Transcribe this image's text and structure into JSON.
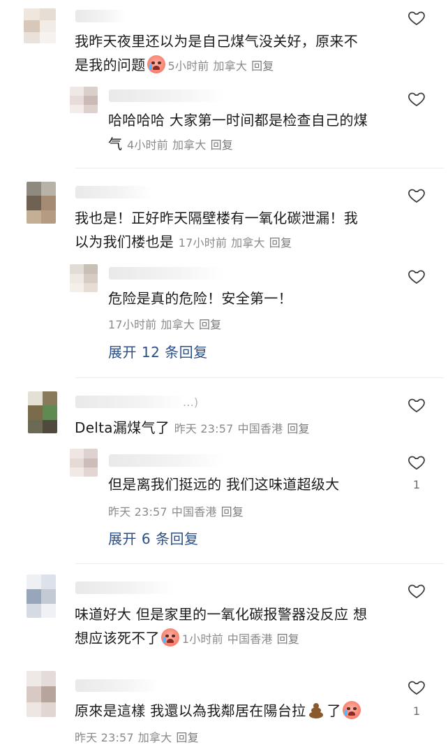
{
  "comments": [
    {
      "text1": "我昨天夜里还以为是自己煤气没关好，原来不",
      "text2": "是我的问题",
      "time": "5小时前",
      "location": "加拿大",
      "reply": "回复",
      "emoji": "face-with-tears-icon"
    },
    {
      "text1": "哈哈哈哈 大家第一时间都是检查自己的煤",
      "text2": "气",
      "time": "4小时前",
      "location": "加拿大",
      "reply": "回复"
    },
    {
      "text1": "我也是！正好昨天隔壁楼有一氧化碳泄漏！我",
      "text2": "以为我们楼也是",
      "time": "17小时前",
      "location": "加拿大",
      "reply": "回复"
    },
    {
      "text1": "危险是真的危险！安全第一！",
      "time": "17小时前",
      "location": "加拿大",
      "reply": "回复",
      "expand": "展开 12 条回复"
    },
    {
      "name_suffix": "...)",
      "text1": "Delta漏煤气了",
      "time": "昨天 23:57",
      "location": "中国香港",
      "reply": "回复"
    },
    {
      "text1": "但是离我们挺远的 我们这味道超级大",
      "time": "昨天 23:57",
      "location": "中国香港",
      "reply": "回复",
      "likes": "1",
      "expand": "展开 6 条回复"
    },
    {
      "text1": "味道好大 但是家里的一氧化碳报警器没反应 想",
      "text2": "想应该死不了",
      "time": "1小时前",
      "location": "中国香港",
      "reply": "回复"
    },
    {
      "text1": "原來是這樣 我還以為我鄰居在陽台拉",
      "text1_tail": "了",
      "time": "昨天 23:57",
      "location": "加拿大",
      "reply": "回复",
      "likes": "1"
    }
  ],
  "colors": {
    "link": "#2b4f86",
    "meta": "#8a8a8a",
    "heart_stroke": "#3a3a3a"
  }
}
